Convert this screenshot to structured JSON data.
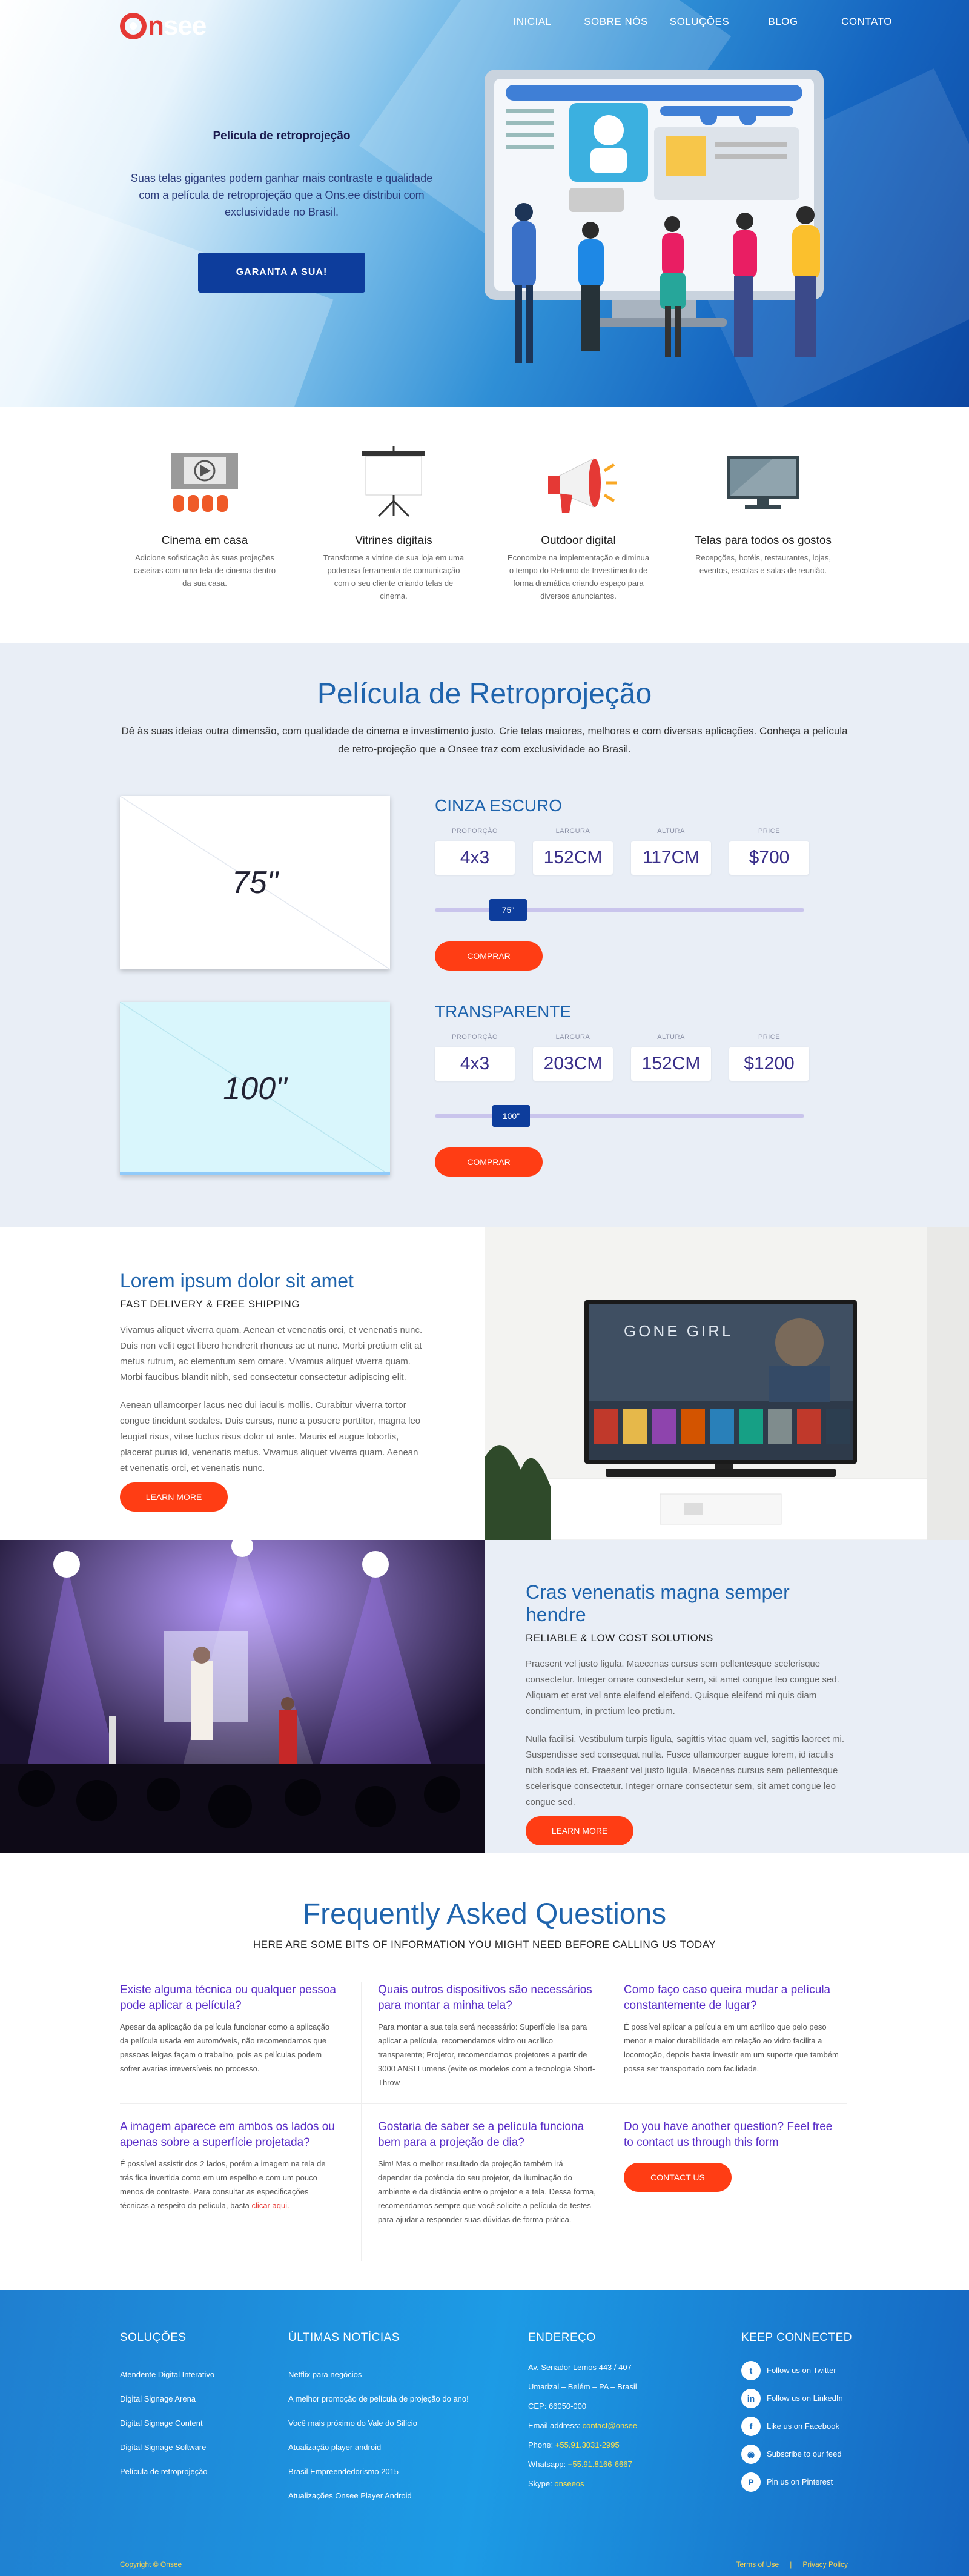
{
  "brand": {
    "name": "onsee"
  },
  "nav": [
    "INICIAL",
    "SOBRE NÓS",
    "SOLUÇÕES",
    "BLOG",
    "CONTATO"
  ],
  "hero": {
    "title": "Película de retroprojeção",
    "text": "Suas telas gigantes podem ganhar mais contraste e qualidade com a película de retroprojeção que a Ons.ee distribui com exclusividade no Brasil.",
    "button": "GARANTA A SUA!"
  },
  "features": [
    {
      "title": "Cinema em casa",
      "text": "Adicione sofisticação às suas projeções caseiras com uma tela de cinema dentro da sua casa.",
      "icon": "cinema-icon"
    },
    {
      "title": "Vitrines digitais",
      "text": "Transforme a vitrine de sua loja em uma poderosa ferramenta de comunicação com o seu cliente criando telas de cinema.",
      "icon": "projection-screen-icon"
    },
    {
      "title": "Outdoor digital",
      "text": "Economize na implementação e diminua o tempo do Retorno de Investimento de forma dramática criando espaço para diversos anunciantes.",
      "icon": "megaphone-icon"
    },
    {
      "title": "Telas para todos os gostos",
      "text": "Recepções, hotéis, restaurantes, lojas, eventos, escolas e salas de reunião.",
      "icon": "monitor-icon"
    }
  ],
  "pricing": {
    "title": "Película de Retroprojeção",
    "intro": "Dê às suas ideias outra dimensão, com qualidade de cinema e investimento justo. Crie telas maiores, melhores e com diversas aplicações. Conheça a película de retro-projeção que a Onsee traz com exclusividade ao Brasil.",
    "labels": {
      "ratio": "PROPORÇÃO",
      "width": "LARGURA",
      "height": "ALTURA",
      "price": "PRICE"
    },
    "products": [
      {
        "name": "CINZA ESCURO",
        "size": "75\"",
        "ratio": "4x3",
        "width": "152CM",
        "height": "117CM",
        "price": "$700",
        "slider": "75\"",
        "button": "COMPRAR",
        "color": "#ffffff"
      },
      {
        "name": "TRANSPARENTE",
        "size": "100\"",
        "ratio": "4x3",
        "width": "203CM",
        "height": "152CM",
        "price": "$1200",
        "slider": "100\"",
        "button": "COMPRAR",
        "color": "#d9f6fc"
      }
    ]
  },
  "split1": {
    "title": "Lorem ipsum dolor sit amet",
    "subtitle": "FAST DELIVERY & FREE SHIPPING",
    "p1": "Vivamus aliquet viverra quam. Aenean et venenatis orci, et venenatis nunc. Duis non velit eget libero hendrerit rhoncus ac ut nunc. Morbi pretium elit at metus rutrum, ac elementum sem ornare. Vivamus aliquet viverra quam. Morbi faucibus blandit nibh, sed consectetur consectetur adipiscing elit.",
    "p2": "Aenean ullamcorper lacus nec dui iaculis mollis. Curabitur viverra tortor congue tincidunt sodales. Duis cursus, nunc a posuere porttitor, magna leo feugiat risus, vitae luctus risus dolor ut ante. Mauris et augue lobortis, placerat purus id, venenatis metus. Vivamus aliquet viverra quam. Aenean et venenatis orci, et venenatis nunc.",
    "button": "LEARN MORE",
    "tv_title": "GONE GIRL"
  },
  "split2": {
    "title": "Cras venenatis magna semper hendre",
    "subtitle": "RELIABLE & LOW COST SOLUTIONS",
    "p1": "Praesent vel justo ligula. Maecenas cursus sem pellentesque scelerisque consectetur. Integer ornare consectetur sem, sit amet congue leo congue sed. Aliquam et erat vel ante eleifend eleifend. Quisque eleifend mi quis diam condimentum, in pretium leo pretium.",
    "p2": "Nulla facilisi. Vestibulum turpis ligula, sagittis vitae quam vel, sagittis laoreet mi. Suspendisse sed consequat nulla. Fusce ullamcorper augue lorem, id iaculis nibh sodales et. Praesent vel justo ligula. Maecenas cursus sem pellentesque scelerisque consectetur. Integer ornare consectetur sem, sit amet congue leo congue sed.",
    "button": "LEARN MORE"
  },
  "faq": {
    "title": "Frequently Asked Questions",
    "subtitle": "HERE ARE SOME BITS OF INFORMATION YOU MIGHT NEED BEFORE CALLING US TODAY",
    "items": [
      {
        "q": "Existe alguma técnica ou qualquer pessoa pode aplicar a película?",
        "a": "Apesar da aplicação da película funcionar como a aplicação da película usada em automóveis, não recomendamos que pessoas leigas façam o trabalho, pois as películas podem sofrer avarias irreversíveis no processo."
      },
      {
        "q": "Quais outros dispositivos são necessários para montar a minha tela?",
        "a": "Para montar a sua tela será necessário: Superfície lisa para aplicar a película, recomendamos vidro ou acrílico transparente; Projetor, recomendamos projetores a partir de 3000 ANSI Lumens (evite os modelos com a tecnologia Short-Throw"
      },
      {
        "q": "Como faço caso queira mudar a película constantemente de lugar?",
        "a": "É possível aplicar a película em um acrílico que pelo peso menor e maior durabilidade em relação ao vidro facilita a locomoção, depois basta investir em um suporte que também possa ser transportado com facilidade."
      },
      {
        "q": "A imagem aparece em ambos os lados ou apenas sobre a superfície projetada?",
        "a": "É possível assistir dos 2 lados, porém a imagem na tela de trás fica invertida como em um espelho e com um pouco menos de contraste. Para consultar as especificações técnicas a respeito da película, basta",
        "link": "clicar aqui."
      },
      {
        "q": "Gostaria de saber se a película funciona bem para a projeção de dia?",
        "a": "Sim! Mas o melhor resultado da projeção também irá depender da potência do seu projetor, da iluminação do ambiente e da distância entre o projetor e a tela. Dessa forma, recomendamos sempre que você solicite a película de testes para ajudar a responder suas dúvidas de forma prática."
      },
      {
        "q": "Do you have another question? Feel free to contact us through this form",
        "button": "CONTACT US"
      }
    ]
  },
  "footer": {
    "col1": {
      "title": "SOLUÇÕES",
      "items": [
        "Atendente Digital Interativo",
        "Digital Signage Arena",
        "Digital Signage Content",
        "Digital Signage Software",
        "Película de retroprojeção"
      ]
    },
    "col2": {
      "title": "ÚLTIMAS NOTÍCIAS",
      "items": [
        "Netflix para negócios",
        "A melhor promoção de película de projeção do ano!",
        "Você mais próximo do Vale do Silício",
        "Atualização player android",
        "Brasil Empreendedorismo 2015",
        "Atualizações Onsee Player Android"
      ]
    },
    "col3": {
      "title": "ENDEREÇO",
      "lines": [
        "Av. Senador Lemos 443 / 407",
        "Umarizal – Belém – PA – Brasil",
        "CEP: 66050-000"
      ],
      "email_label": "Email address:",
      "email": "contact@onsee",
      "phone_label": "Phone:",
      "phone": "+55.91.3031-2995",
      "whatsapp_label": "Whatsapp:",
      "whatsapp": "+55.91.8166-6667",
      "skype_label": "Skype:",
      "skype": "onseeos"
    },
    "col4": {
      "title": "KEEP CONNECTED",
      "items": [
        {
          "icon": "twitter-icon",
          "label": "Follow us on Twitter",
          "glyph": "t"
        },
        {
          "icon": "linkedin-icon",
          "label": "Follow us on LinkedIn",
          "glyph": "in"
        },
        {
          "icon": "facebook-icon",
          "label": "Like us on Facebook",
          "glyph": "f"
        },
        {
          "icon": "rss-icon",
          "label": "Subscribe to our feed",
          "glyph": "◉"
        },
        {
          "icon": "pinterest-icon",
          "label": "Pin us on Pinterest",
          "glyph": "P"
        }
      ]
    },
    "copyright": "Copyright © Onsee",
    "terms": "Terms of Use",
    "sep": "|",
    "privacy": "Privacy Policy"
  }
}
